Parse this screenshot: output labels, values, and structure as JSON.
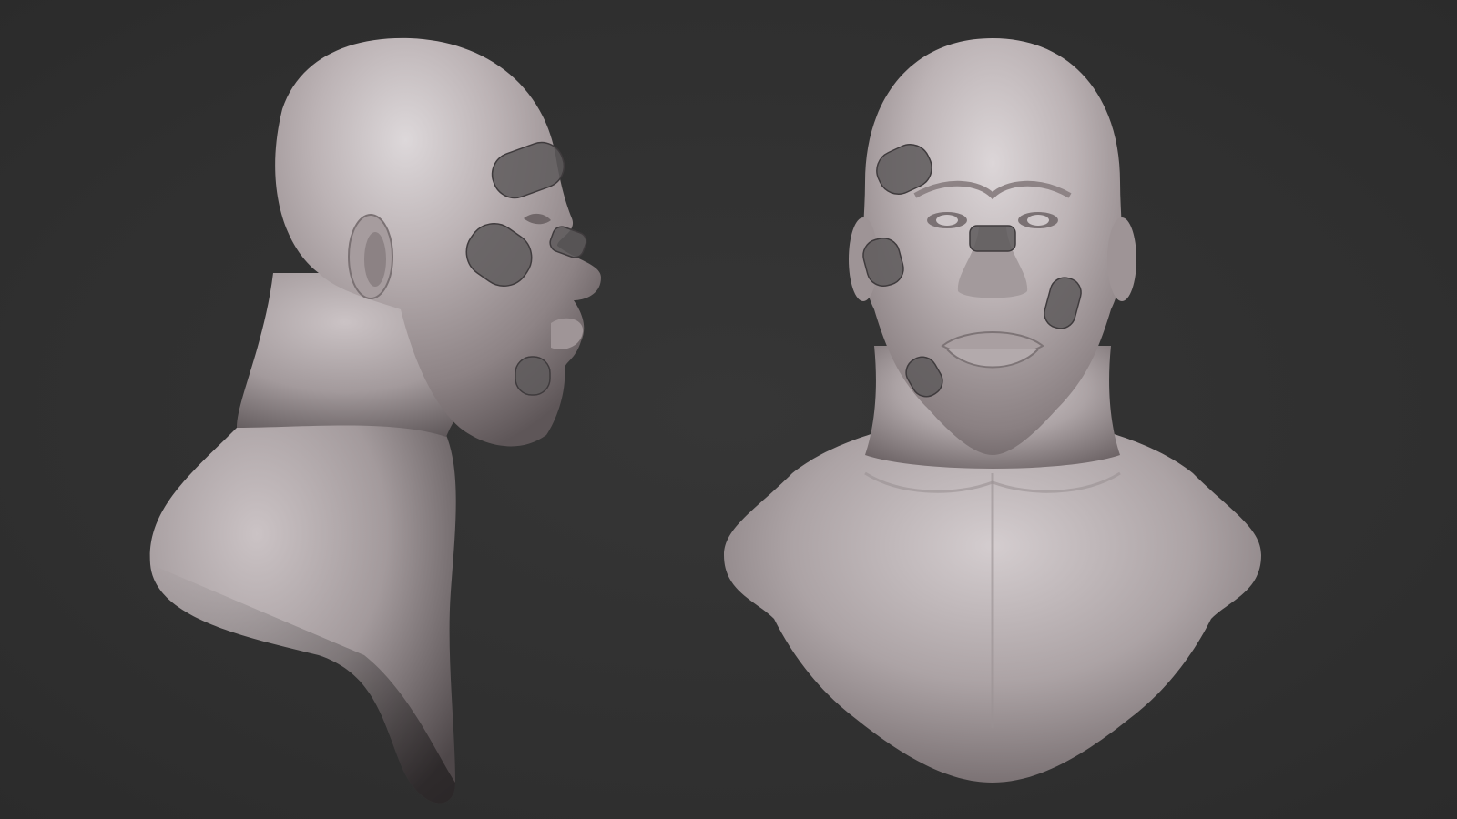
{
  "scene": {
    "background_color": "#313131",
    "clay_color": "#b7aeb0",
    "bandage_color": "#5e5a5c",
    "views": [
      {
        "id": "side",
        "description_name": "profile-view"
      },
      {
        "id": "front",
        "description_name": "front-view"
      }
    ]
  }
}
